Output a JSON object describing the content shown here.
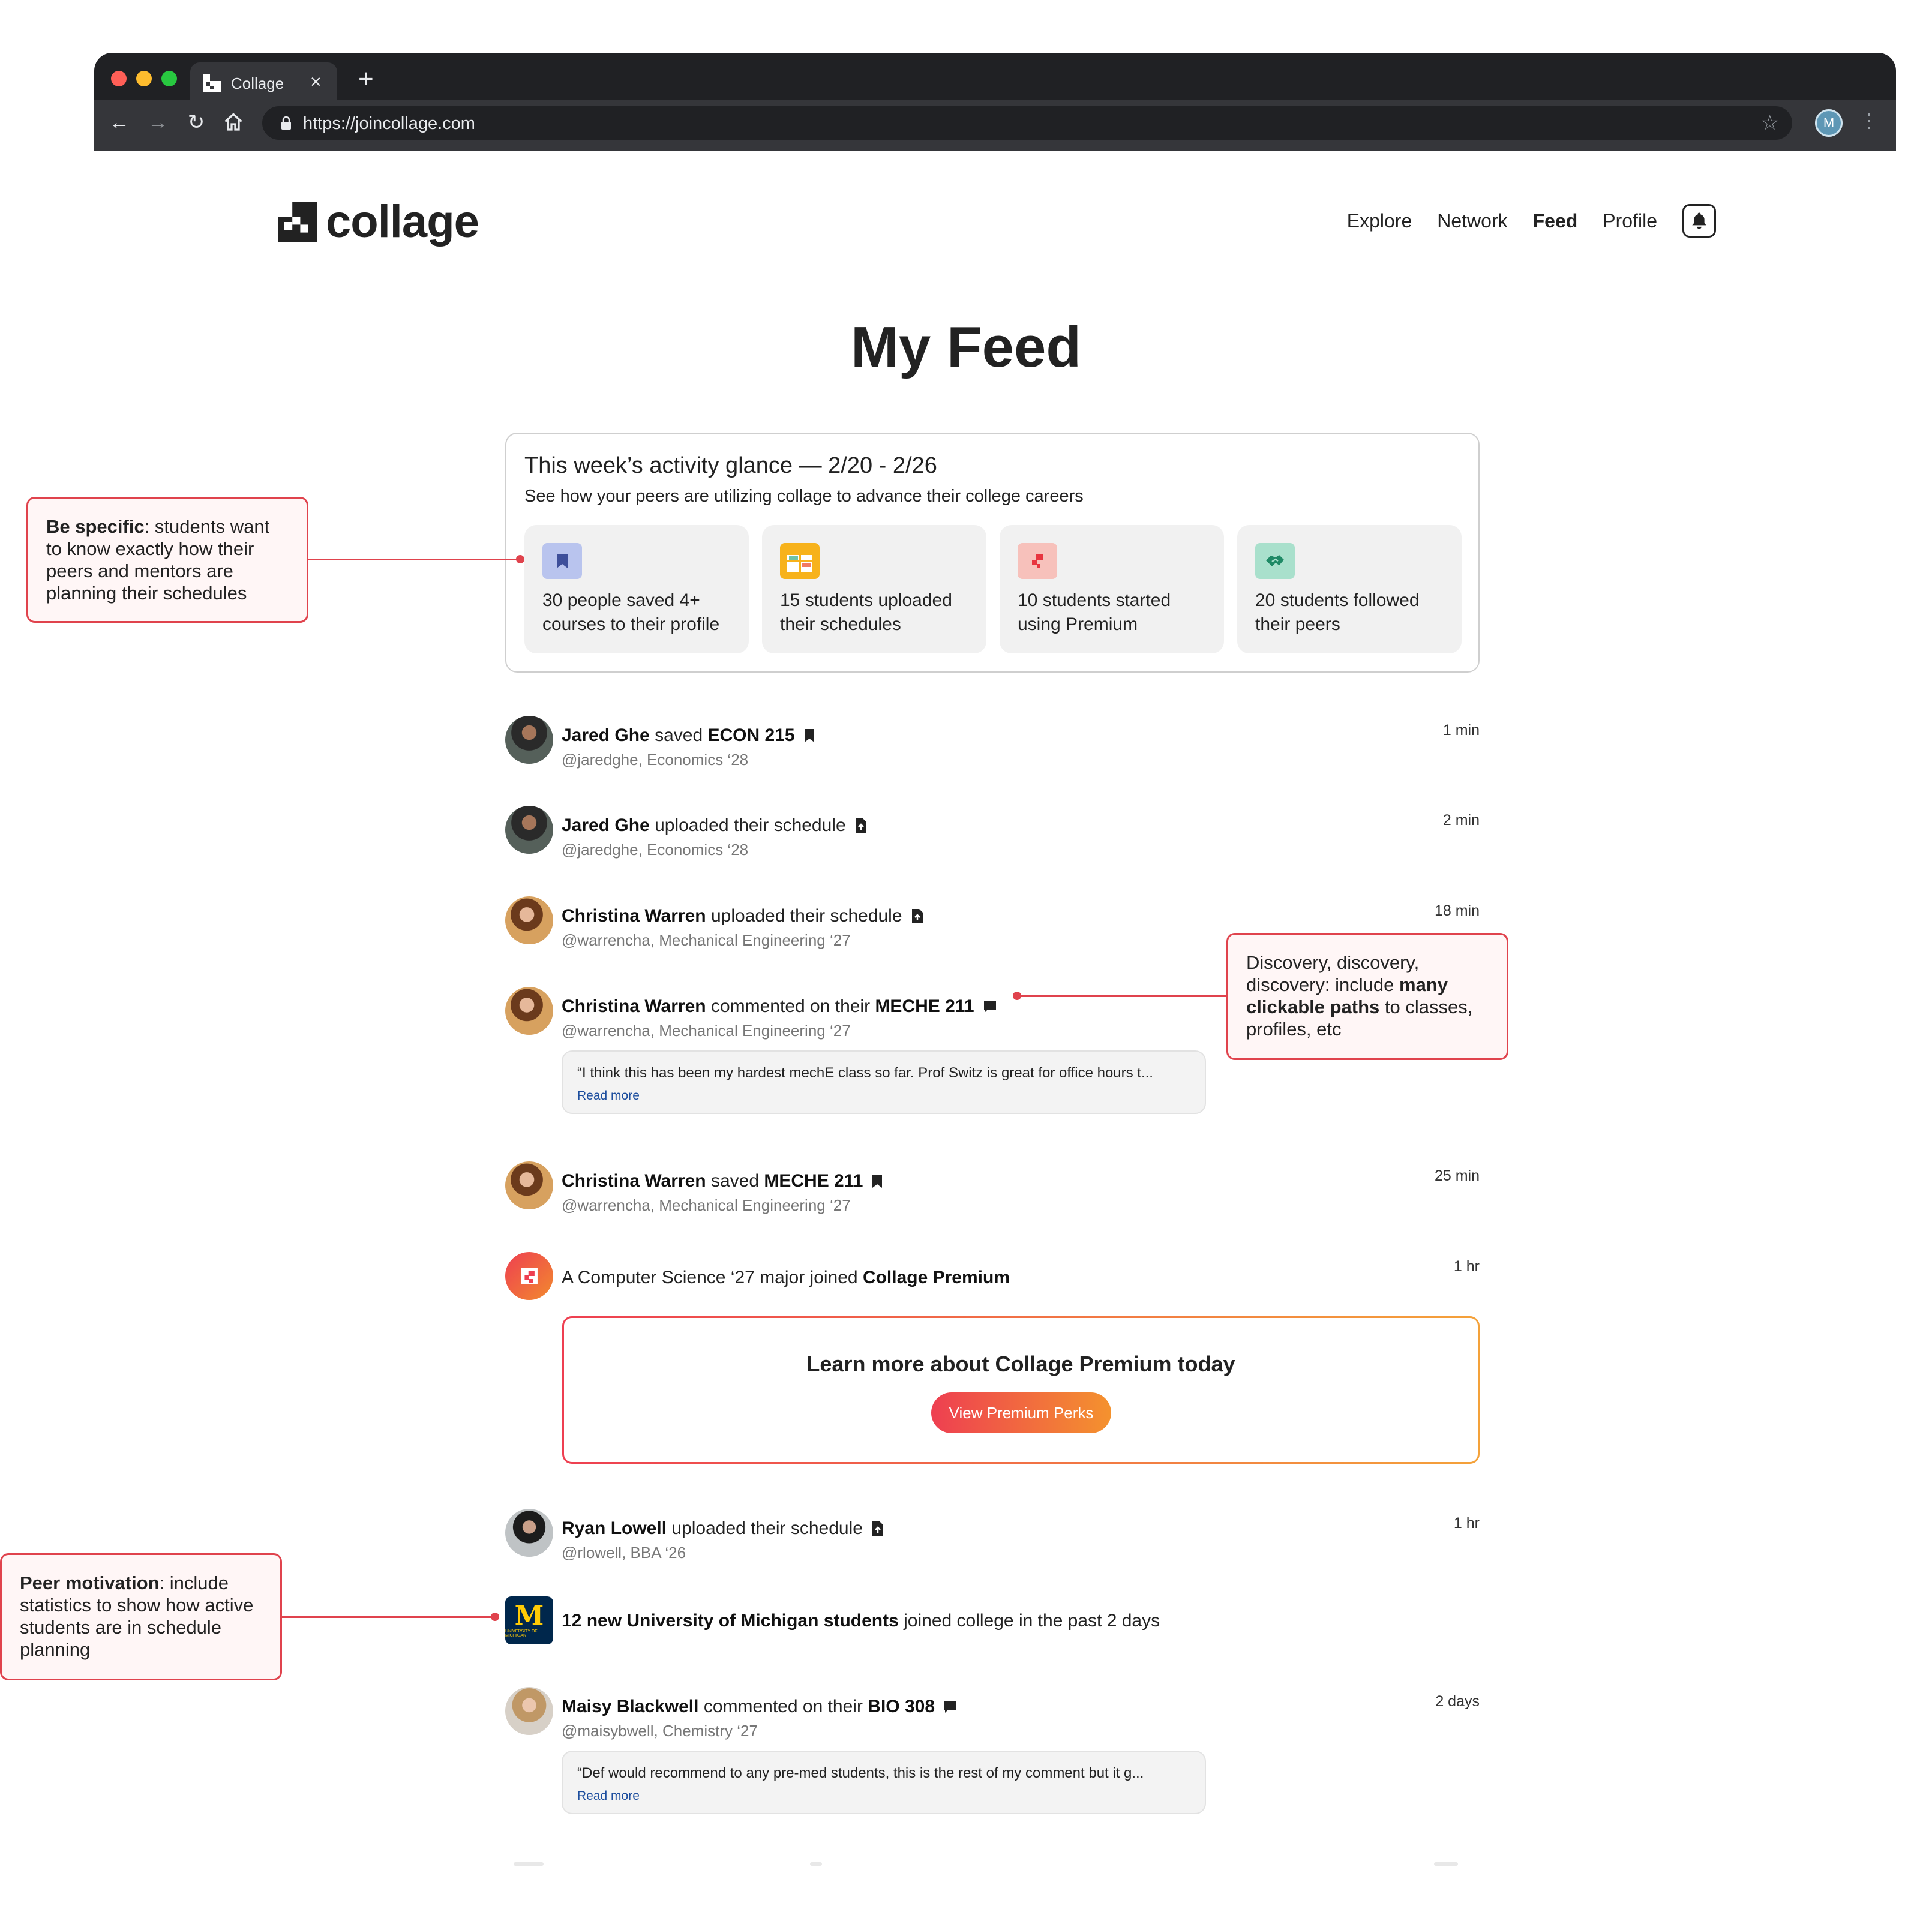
{
  "browser": {
    "tab_title": "Collage",
    "tab_close": "×",
    "new_tab": "+",
    "url": "https://joincollage.com",
    "profile_initial": "M"
  },
  "site": {
    "logo_text": "collage",
    "nav": {
      "explore": "Explore",
      "network": "Network",
      "feed": "Feed",
      "profile": "Profile"
    }
  },
  "page_title": "My Feed",
  "glance": {
    "title": "This week’s activity glance — 2/20 - 2/26",
    "subtitle": "See how your peers are utilizing collage to advance their college careers",
    "stats": [
      {
        "text": "30 people saved 4+ courses to their profile",
        "icon": "bookmark-icon",
        "color": "#b9c4ee"
      },
      {
        "text": "15 students uploaded their schedules",
        "icon": "schedule-grid-icon",
        "color": "#f7b21b"
      },
      {
        "text": "10 students started using Premium",
        "icon": "premium-icon",
        "color": "#f7c1bb"
      },
      {
        "text": "20 students followed their peers",
        "icon": "handshake-icon",
        "color": "#a9e0cc"
      }
    ]
  },
  "feed": [
    {
      "name": "Jared Ghe",
      "action": "saved",
      "target": "ECON 215",
      "handle": "@jaredghe, Economics ‘28",
      "time": "1 min",
      "icon": "bookmark-icon"
    },
    {
      "name": "Jared Ghe",
      "action": "uploaded their schedule",
      "handle": "@jaredghe, Economics ‘28",
      "time": "2 min",
      "icon": "file-upload-icon"
    },
    {
      "name": "Christina Warren",
      "action": "uploaded their schedule",
      "handle": "@warrencha, Mechanical Engineering ‘27",
      "time": "18 min",
      "icon": "file-upload-icon"
    },
    {
      "name": "Christina Warren",
      "action": "commented on their",
      "target": "MECHE 211",
      "handle": "@warrencha, Mechanical Engineering ‘27",
      "icon": "comment-icon",
      "comment": "“I think this has been my hardest mechE class so far. Prof Switz is great for office hours t...",
      "read_more": "Read more"
    },
    {
      "name": "Christina Warren",
      "action": "saved",
      "target": "MECHE 211",
      "handle": "@warrencha, Mechanical Engineering ‘27",
      "time": "25 min",
      "icon": "bookmark-icon"
    },
    {
      "prefix": "A Computer Science ‘27 major joined",
      "target": "Collage Premium",
      "time": "1 hr"
    },
    {
      "name": "Ryan Lowell",
      "action": "uploaded their schedule",
      "handle": "@rlowell, BBA ‘26",
      "time": "1 hr",
      "icon": "file-upload-icon"
    },
    {
      "prefix_bold": "12 new University of Michigan students",
      "suffix": "joined college in the past 2 days",
      "logo_letter": "M",
      "logo_sub": "UNIVERSITY OF MICHIGAN"
    },
    {
      "name": "Maisy Blackwell",
      "action": "commented on their",
      "target": "BIO 308",
      "handle": "@maisybwell, Chemistry ‘27",
      "time": "2 days",
      "icon": "comment-icon",
      "comment": "“Def would recommend to any pre-med students, this is the rest of my comment but it g...",
      "read_more": "Read more"
    }
  ],
  "premium_promo": {
    "title": "Learn more about Collage Premium today",
    "button": "View Premium Perks"
  },
  "annotations": {
    "specific_bold": "Be specific",
    "specific_rest": ": students want to know exactly how their peers and mentors are planning their schedules",
    "discovery_1": "Discovery, discovery, discovery: include ",
    "discovery_bold": "many clickable paths",
    "discovery_2": " to classes, profiles, etc",
    "peer_bold": "Peer motivation",
    "peer_rest": ": include statistics to show how active students are in schedule planning"
  },
  "colors": {
    "accent_red": "#e0434d",
    "premium_start": "#ee3f51",
    "premium_end": "#f4a23a",
    "link_blue": "#1d4e9e"
  }
}
